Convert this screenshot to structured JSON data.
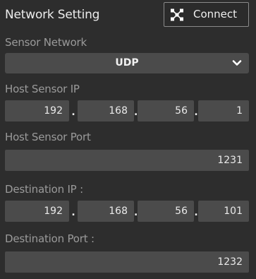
{
  "header": {
    "title": "Network Setting",
    "connect_label": "Connect",
    "connect_icon": "network-nodes-icon"
  },
  "sensor_network": {
    "label": "Sensor Network",
    "selected": "UDP",
    "dropdown_icon": "chevron-down-icon"
  },
  "host_sensor_ip": {
    "label": "Host Sensor IP",
    "octets": [
      "192",
      "168",
      "56",
      "1"
    ],
    "separator": "."
  },
  "host_sensor_port": {
    "label": "Host Sensor Port",
    "value": "1231"
  },
  "destination_ip": {
    "label": "Destination IP :",
    "octets": [
      "192",
      "168",
      "56",
      "101"
    ],
    "separator": "."
  },
  "destination_port": {
    "label": "Destination Port :",
    "value": "1232"
  },
  "colors": {
    "background": "#2d2d2d",
    "field": "#4b4b4b",
    "label": "#9a9a9a",
    "text": "#ececec"
  }
}
